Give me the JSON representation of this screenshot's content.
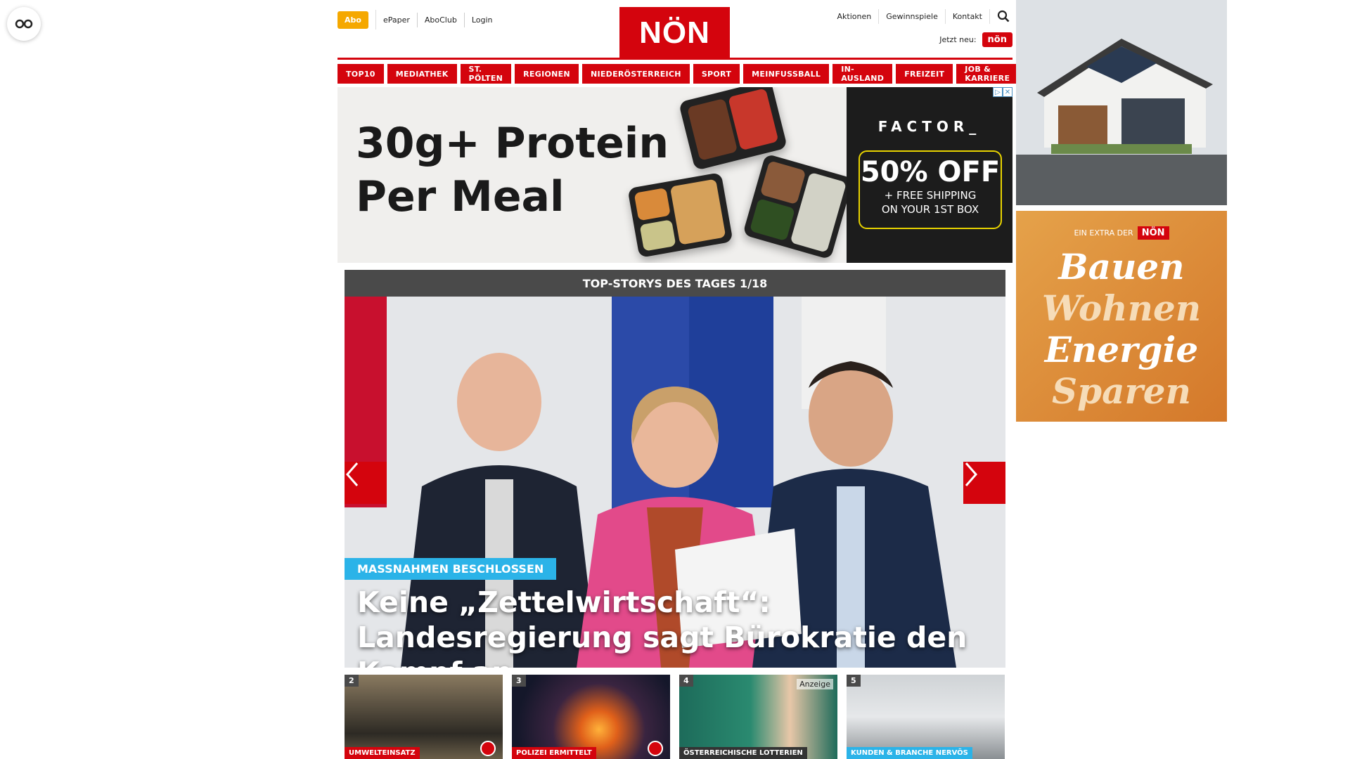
{
  "header": {
    "abo": "Abo",
    "links": [
      "ePaper",
      "AboClub",
      "Login"
    ],
    "logo": "NÖN",
    "right_links": [
      "Aktionen",
      "Gewinnspiele",
      "Kontakt"
    ],
    "jetzt_label": "Jetzt neu:",
    "jetzt_badge": "nön"
  },
  "nav": [
    "TOP10",
    "MEDIATHEK",
    "ST. PÖLTEN",
    "REGIONEN",
    "NIEDERÖSTERREICH",
    "SPORT",
    "MEINFUSSBALL",
    "IN-AUSLAND",
    "FREIZEIT",
    "JOB & KARRIERE"
  ],
  "ad": {
    "headline": "30g+ Protein\nPer Meal",
    "brand": "FACTOR_",
    "offer": "50% OFF",
    "offer_sub": "+ FREE SHIPPING\nON YOUR 1ST BOX"
  },
  "stories": {
    "header": "TOP-STORYS DES TAGES 1/18",
    "kicker": "MASSNAHMEN BESCHLOSSEN",
    "title": "Keine „Zettelwirtschaft“: Landesregierung sagt Bürokratie den Kampf an",
    "thumbs": [
      {
        "num": "2",
        "tag": "UMWELTEINSATZ",
        "style": "red",
        "anzeige": ""
      },
      {
        "num": "3",
        "tag": "POLIZEI ERMITTELT",
        "style": "red",
        "anzeige": ""
      },
      {
        "num": "4",
        "tag": "ÖSTERREICHISCHE LOTTERIEN",
        "style": "dark",
        "anzeige": "Anzeige"
      },
      {
        "num": "5",
        "tag": "KUNDEN & BRANCHE NERVÖS",
        "style": "blue",
        "anzeige": ""
      }
    ]
  },
  "side": {
    "extra_label": "EIN EXTRA DER",
    "extra_logo": "NÖN",
    "words": [
      "Bauen",
      "Wohnen",
      "Energie",
      "Sparen"
    ]
  }
}
